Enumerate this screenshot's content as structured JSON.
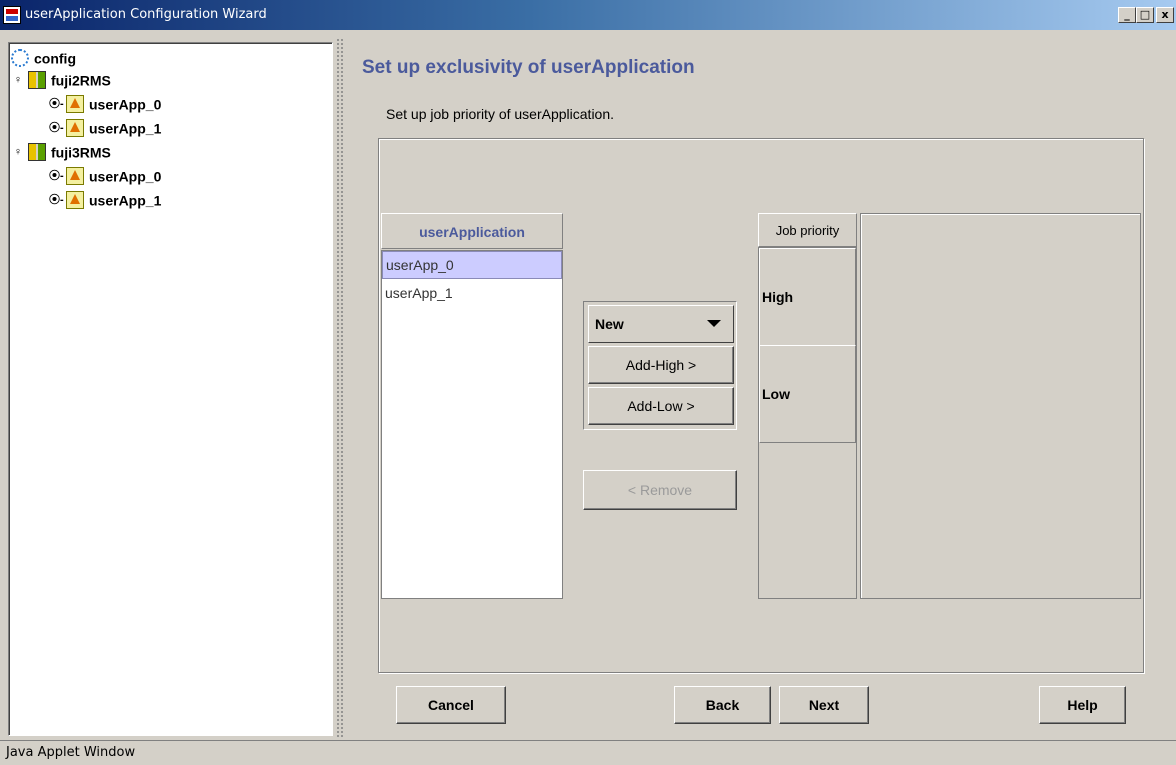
{
  "window": {
    "title": "userApplication Configuration Wizard",
    "min_label": "_",
    "max_label": "□",
    "close_label": "x"
  },
  "tree": {
    "root": "config",
    "hosts": [
      {
        "label": "fuji2RMS",
        "apps": [
          "userApp_0",
          "userApp_1"
        ]
      },
      {
        "label": "fuji3RMS",
        "apps": [
          "userApp_0",
          "userApp_1"
        ]
      }
    ]
  },
  "page": {
    "heading": "Set up exclusivity of userApplication",
    "description": "Set up job priority of userApplication."
  },
  "app_list": {
    "header": "userApplication",
    "items": [
      "userApp_0",
      "userApp_1"
    ],
    "selected_index": 0
  },
  "controls": {
    "dropdown_value": "New",
    "add_high": "Add-High >",
    "add_low": "Add-Low >",
    "remove": "< Remove"
  },
  "priority": {
    "header": "Job priority",
    "rows": [
      "High",
      "Low"
    ]
  },
  "buttons": {
    "cancel": "Cancel",
    "back": "Back",
    "next": "Next",
    "help": "Help"
  },
  "status_bar": "Java Applet Window"
}
